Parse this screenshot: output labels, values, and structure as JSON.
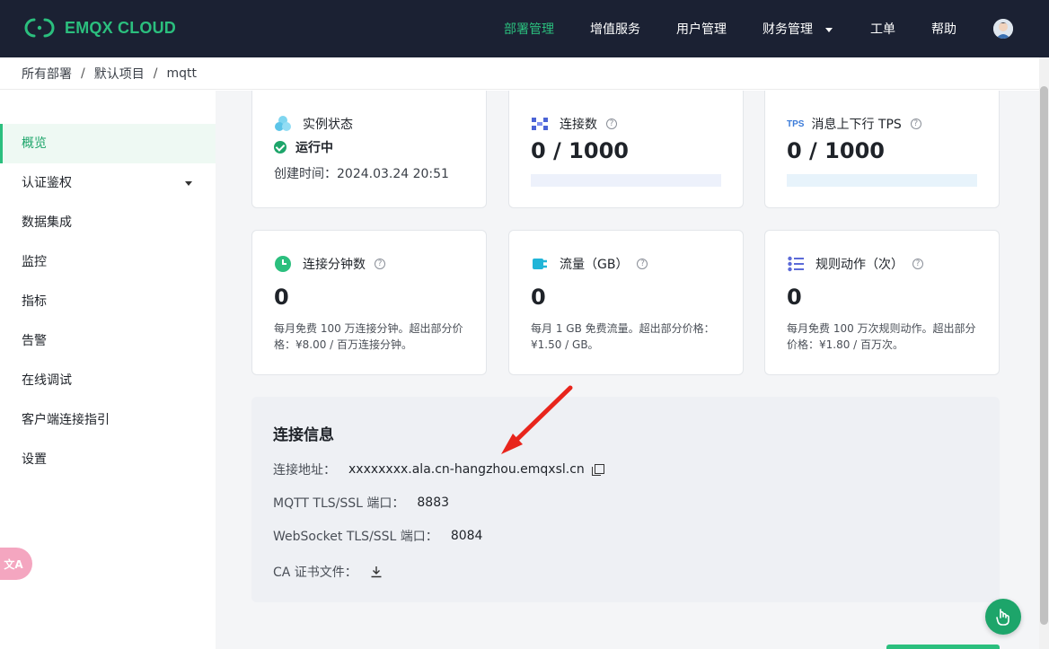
{
  "app": {
    "brand": "EMQX CLOUD",
    "accent_color": "#2bbf7e",
    "header_bg": "#1b2133"
  },
  "nav": {
    "items": [
      {
        "label": "部署管理",
        "active": true
      },
      {
        "label": "增值服务"
      },
      {
        "label": "用户管理"
      },
      {
        "label": "财务管理",
        "has_dropdown": true
      },
      {
        "label": "工单"
      },
      {
        "label": "帮助"
      }
    ],
    "avatar_icon": "user-avatar-icon"
  },
  "breadcrumb": {
    "items": [
      "所有部署",
      "默认项目",
      "mqtt"
    ],
    "separator": "/"
  },
  "sidebar": {
    "items": [
      {
        "label": "概览",
        "active": true
      },
      {
        "label": "认证鉴权",
        "expandable": true
      },
      {
        "label": "数据集成"
      },
      {
        "label": "监控"
      },
      {
        "label": "指标"
      },
      {
        "label": "告警"
      },
      {
        "label": "在线调试"
      },
      {
        "label": "客户端连接指引"
      },
      {
        "label": "设置"
      }
    ],
    "translate_button": "文A"
  },
  "cards": {
    "status": {
      "title": "实例状态",
      "state": "运行中",
      "created_label": "创建时间：",
      "created_value": "2024.03.24 20:51"
    },
    "connections": {
      "title": "连接数",
      "value": "0 / 1000",
      "progress": 0
    },
    "tps": {
      "badge": "TPS",
      "title": "消息上下行 TPS",
      "value": "0 / 1000",
      "progress": 0
    },
    "conn_minutes": {
      "title": "连接分钟数",
      "value": "0",
      "desc": "每月免费 100 万连接分钟。超出部分价格：¥8.00 / 百万连接分钟。"
    },
    "traffic": {
      "title": "流量（GB）",
      "value": "0",
      "desc": "每月 1 GB 免费流量。超出部分价格：¥1.50 / GB。"
    },
    "rule_actions": {
      "title": "规则动作（次）",
      "value": "0",
      "desc": "每月免费 100 万次规则动作。超出部分价格：¥1.80 / 百万次。"
    }
  },
  "connection_info": {
    "title": "连接信息",
    "address_label": "连接地址：",
    "address_value": "xxxxxxxx.ala.cn-hangzhou.emqxsl.cn",
    "mqtt_label": "MQTT TLS/SSL 端口：",
    "mqtt_value": "8883",
    "ws_label": "WebSocket TLS/SSL 端口：",
    "ws_value": "8084",
    "ca_label": "CA 证书文件："
  },
  "annotation": {
    "arrow_color": "#e8251c"
  }
}
